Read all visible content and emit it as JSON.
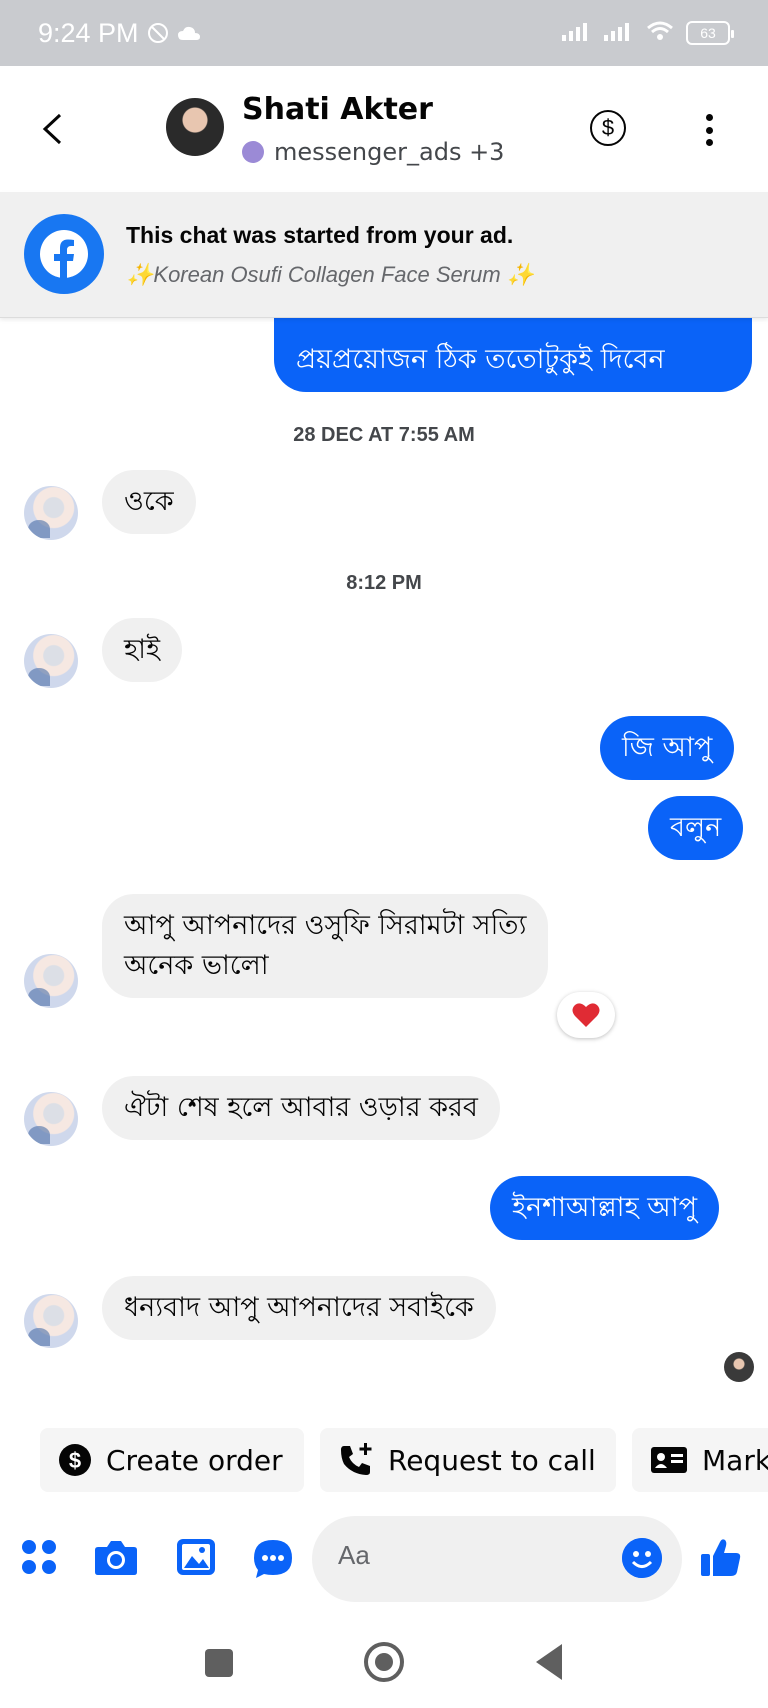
{
  "status_bar": {
    "time": "9:24 PM",
    "battery": "63"
  },
  "header": {
    "contact_name": "Shati Akter",
    "contact_sub": "messenger_ads +3"
  },
  "ad_banner": {
    "title": "This chat was started from your ad.",
    "product": "✨Korean Osufi Collagen Face Serum ✨"
  },
  "messages": {
    "m0": "প্রয়প্রয়োজন ঠিক ততোটুকুই দিবেন",
    "stamp1": "28 DEC AT 7:55 AM",
    "m1": "ওকে",
    "stamp2": "8:12 PM",
    "m2": "হাই",
    "m3": "জি আপু",
    "m4": "বলুন",
    "m5_line1": "আপু আপনাদের ওসুফি সিরামটা সত্যি",
    "m5_line2": "অনেক ভালো",
    "m5_reaction": "heart",
    "m6": "ঐটা শেষ হলে আবার ওড়ার করব",
    "m7": "ইনশাআল্লাহ আপু",
    "m8": "ধন্যবাদ আপু আপনাদের সবাইকে"
  },
  "quick_actions": {
    "create_order": "Create order",
    "request_call": "Request to call",
    "mark": "Mark"
  },
  "composer": {
    "placeholder": "Aa"
  },
  "colors": {
    "accent": "#0a63f8",
    "bubble_in": "#f0f0f0",
    "facebook": "#1877f2"
  }
}
